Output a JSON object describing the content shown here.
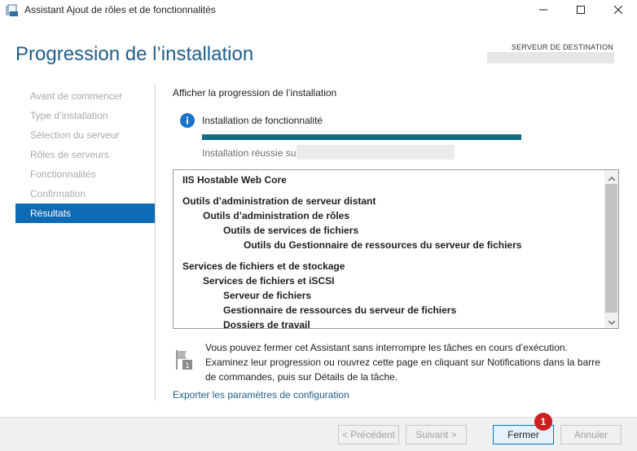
{
  "window": {
    "title": "Assistant Ajout de rôles et de fonctionnalités"
  },
  "header": {
    "title": "Progression de l’installation",
    "destination_label": "SERVEUR DE DESTINATION"
  },
  "sidebar": {
    "items": [
      {
        "label": "Avant de commencer",
        "state": "disabled"
      },
      {
        "label": "Type d’installation",
        "state": "disabled"
      },
      {
        "label": "Sélection du serveur",
        "state": "disabled"
      },
      {
        "label": "Rôles de serveurs",
        "state": "disabled"
      },
      {
        "label": "Fonctionnalités",
        "state": "disabled"
      },
      {
        "label": "Confirmation",
        "state": "disabled"
      },
      {
        "label": "Résultats",
        "state": "active"
      }
    ]
  },
  "main": {
    "progress_heading": "Afficher la progression de l’installation",
    "install_type": "Installation de fonctionnalité",
    "progress_percent": 100,
    "result_text": "Installation réussie sur",
    "features": [
      {
        "label": "IIS Hostable Web Core",
        "level": 0
      },
      {
        "label": "Outils d’administration de serveur distant",
        "level": 0
      },
      {
        "label": "Outils d’administration de rôles",
        "level": 1
      },
      {
        "label": "Outils de services de fichiers",
        "level": 2
      },
      {
        "label": "Outils du Gestionnaire de ressources du serveur de fichiers",
        "level": 3
      },
      {
        "label": "Services de fichiers et de stockage",
        "level": 0
      },
      {
        "label": "Services de fichiers et iSCSI",
        "level": 1
      },
      {
        "label": "Serveur de fichiers",
        "level": 2
      },
      {
        "label": "Gestionnaire de ressources du serveur de fichiers",
        "level": 2
      },
      {
        "label": "Dossiers de travail",
        "level": 2
      }
    ],
    "note": "Vous pouvez fermer cet Assistant sans interrompre les tâches en cours d’exécution. Examinez leur progression ou rouvrez cette page en cliquant sur Notifications dans la barre de commandes, puis sur Détails de la tâche.",
    "note_icon_badge": "1",
    "export_link": "Exporter les paramètres de configuration"
  },
  "footer": {
    "prev_label": "< Précédent",
    "next_label": "Suivant >",
    "close_label": "Fermer",
    "cancel_label": "Annuler",
    "callout_badge": "1"
  },
  "colors": {
    "accent": "#0f6ab4",
    "title_blue": "#1f5f8b",
    "progress": "#0f6f80",
    "badge_red": "#cc1f1f"
  }
}
